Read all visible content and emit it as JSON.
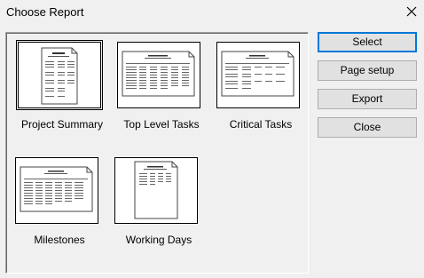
{
  "window": {
    "title": "Choose Report"
  },
  "reports": [
    {
      "label": "Project Summary",
      "selected": true
    },
    {
      "label": "Top Level Tasks",
      "selected": false
    },
    {
      "label": "Critical Tasks",
      "selected": false
    },
    {
      "label": "Milestones",
      "selected": false
    },
    {
      "label": "Working Days",
      "selected": false
    }
  ],
  "buttons": {
    "select": "Select",
    "page_setup": "Page setup",
    "export": "Export",
    "close": "Close"
  },
  "colors": {
    "accent": "#0078d7",
    "background": "#f0f0f0"
  }
}
